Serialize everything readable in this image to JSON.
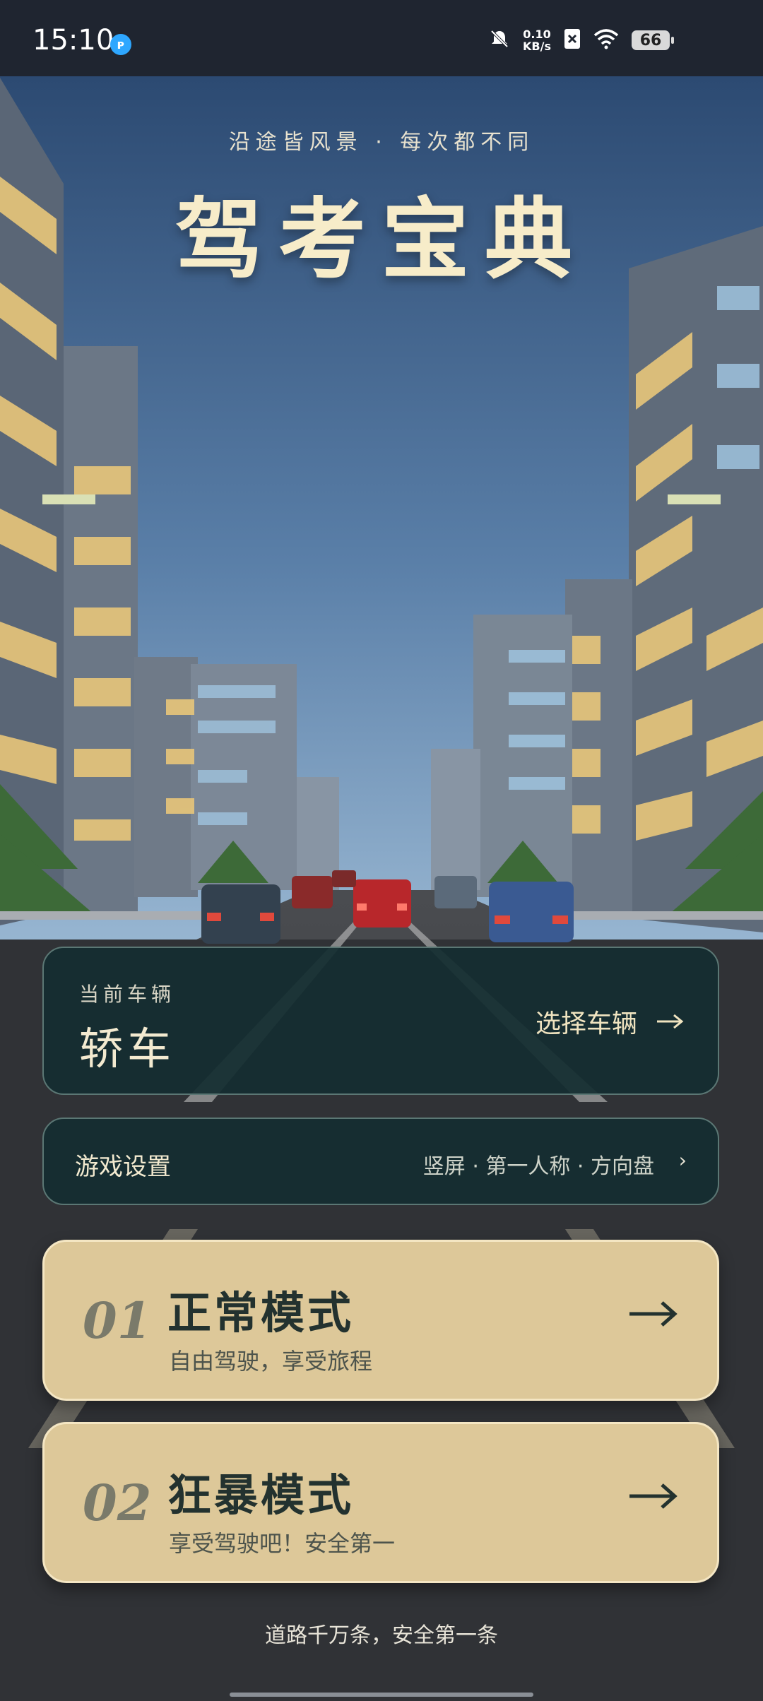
{
  "status_bar": {
    "time": "15:10",
    "app_icon": "app-badge",
    "net_speed_value": "0.10",
    "net_speed_unit": "KB/s",
    "battery": "66"
  },
  "header": {
    "subtitle": "沿途皆风景 · 每次都不同",
    "title": "驾考宝典"
  },
  "vehicle": {
    "caption": "当前车辆",
    "name": "轿车",
    "select_label": "选择车辆"
  },
  "settings": {
    "label": "游戏设置",
    "summary": "竖屏 · 第一人称 · 方向盘"
  },
  "modes": [
    {
      "index": "01",
      "title": "正常模式",
      "desc": "自由驾驶，享受旅程"
    },
    {
      "index": "02",
      "title": "狂暴模式",
      "desc": "享受驾驶吧！安全第一"
    }
  ],
  "footer": {
    "slogan": "道路千万条，安全第一条"
  },
  "colors": {
    "sky_top": "#2c4a72",
    "sky_bottom": "#7fa2c6",
    "card_dark": "#14302f",
    "card_gold": "#ddc899",
    "title_cream": "#f7ecc9"
  }
}
